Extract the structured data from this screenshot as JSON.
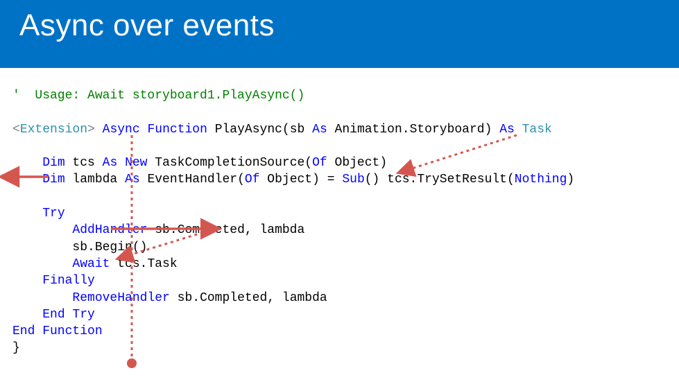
{
  "title": "Async over events",
  "code": {
    "commentPrefix": "'  ",
    "commentText": "Usage: Await storyboard1.PlayAsync()",
    "extOpen": "<",
    "extName": "Extension",
    "extClose": ">",
    "asyncKw": "Async",
    "functionKw": "Function",
    "funcName": " PlayAsync(sb ",
    "asKw": "As",
    "animStoryboard": " Animation.Storyboard) ",
    "taskType": "Task",
    "dimKw": "Dim",
    "tcsDecl": " tcs ",
    "newKw": "New",
    "tcsType": " TaskCompletionSource(",
    "ofKw": "Of",
    "objType": " Object",
    "closeParen": ")",
    "lambdaDecl": " lambda ",
    "ehType": " EventHandler(",
    "eqSub": ") = ",
    "subKw": "Sub",
    "lambdaBody": "() tcs.TrySetResult(",
    "nothingKw": "Nothing",
    "tryKw": "Try",
    "addHandlerKw": "AddHandler",
    "addHandlerArgs": " sb.Completed, lambda",
    "beginCall": "sb.Begin()",
    "awaitKw": "Await",
    "awaitExpr": " tcs.Task",
    "finallyKw": "Finally",
    "removeHandlerKw": "RemoveHandler",
    "removeHandlerArgs": " sb.Completed, lambda",
    "endKw": "End",
    "tryWord": " Try",
    "functionWord": " Function",
    "braceClose": "}"
  }
}
